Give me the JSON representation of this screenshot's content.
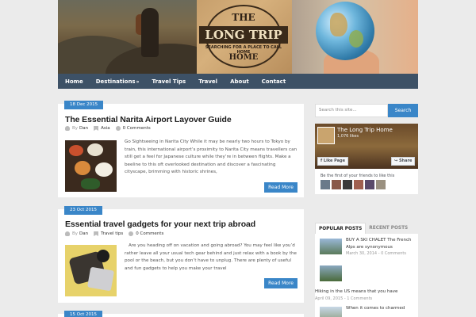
{
  "site": {
    "logo_top": "THE",
    "logo_main": "LONG TRIP",
    "logo_tagline": "SEARCHING FOR A PLACE TO CALL HOME",
    "logo_bottom": "HOME"
  },
  "nav": {
    "items": [
      {
        "label": "Home"
      },
      {
        "label": "Destinations",
        "has_submenu": true
      },
      {
        "label": "Travel Tips"
      },
      {
        "label": "Travel"
      },
      {
        "label": "About"
      },
      {
        "label": "Contact"
      }
    ],
    "submenu_arrow": "»"
  },
  "posts": [
    {
      "date": "18 Dec 2015",
      "title": "The Essential Narita Airport Layover Guide",
      "by_label": "By",
      "author": "Dan",
      "category": "Asia",
      "comments": "0 Comments",
      "excerpt": "Go Sightseeing in Narita City While it may be nearly two hours to Tokyo by train, this international airport’s proximity to Narita City means travellers can still get a feel for Japanese culture while they’re in between flights. Make a beeline to this oft overlooked destination and discover a fascinating cityscape, brimming with historic shrines,",
      "read_more": "Read More"
    },
    {
      "date": "23 Oct 2015",
      "title": "Essential travel gadgets for your next trip abroad",
      "by_label": "By",
      "author": "Dan",
      "category": "Travel tips",
      "comments": "0 Comments",
      "excerpt": "Are you heading off on vacation and going abroad? You may feel like you’d rather leave all your usual tech gear behind and just relax with a book by the pool or the beach, but you don’t have to unplug. There are plenty of useful and fun gadgets to help you make your travel",
      "read_more": "Read More"
    },
    {
      "date": "15 Oct 2015"
    }
  ],
  "sidebar": {
    "search": {
      "placeholder": "Search this site...",
      "button": "Search"
    },
    "facebook": {
      "page_name": "The Long Trip Home",
      "likes": "1,076 likes",
      "like_button": "Like Page",
      "share_button": "Share",
      "friends_text": "Be the first of your friends to like this"
    },
    "tabs": [
      {
        "label": "POPULAR POSTS",
        "active": true
      },
      {
        "label": "RECENT POSTS",
        "active": false
      }
    ],
    "popular_posts": [
      {
        "title": "BUY A SKI CHALET The French Alps are synonymous",
        "date": "March 30, 2014",
        "comments": "0 Comments"
      },
      {
        "title": "Hiking in the US means that you have",
        "date": "April 09, 2015",
        "comments": "1 Comments"
      },
      {
        "title": "When it comes to charmed"
      }
    ]
  },
  "colors": {
    "accent": "#3a86c8",
    "nav_bg": "#3d5166",
    "page_bg": "#ebebeb"
  }
}
